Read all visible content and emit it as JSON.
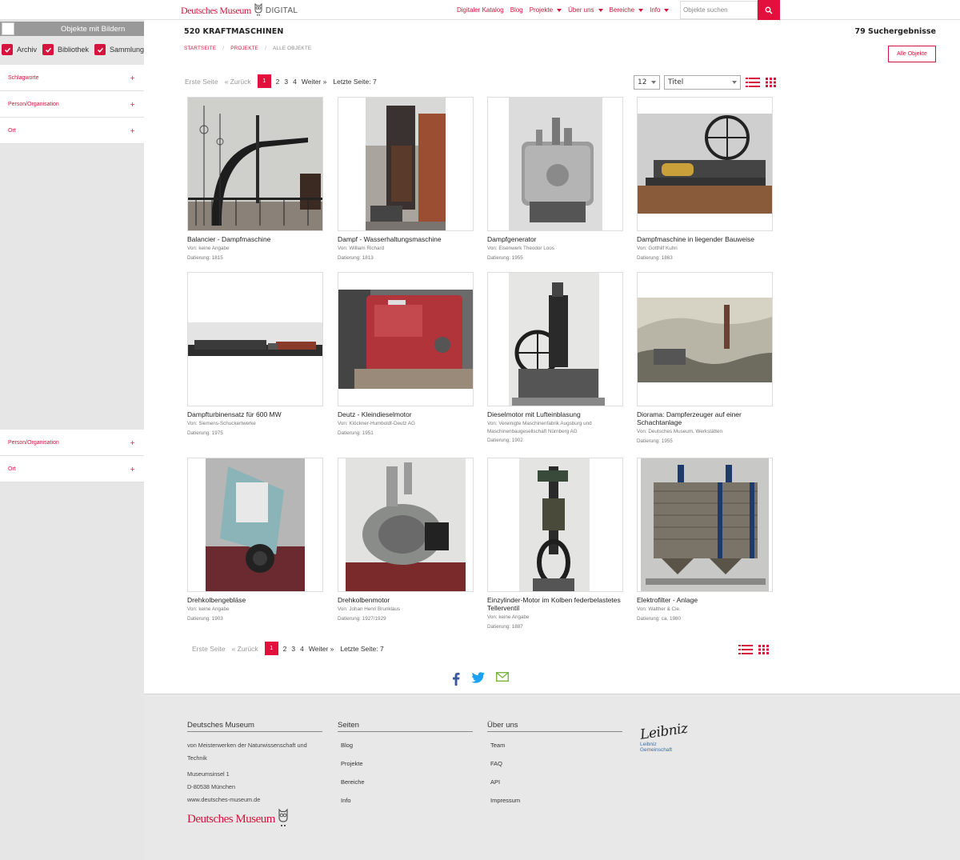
{
  "header": {
    "brand": "Deutsches Museum",
    "digital": "DIGITAL",
    "nav": [
      {
        "label": "Digitaler Katalog",
        "dropdown": false
      },
      {
        "label": "Blog",
        "dropdown": false
      },
      {
        "label": "Projekte",
        "dropdown": true
      },
      {
        "label": "Über uns",
        "dropdown": true
      },
      {
        "label": "Bereiche",
        "dropdown": true
      },
      {
        "label": "Info",
        "dropdown": true
      }
    ],
    "search_placeholder": "Objekte suchen"
  },
  "sidebar": {
    "with_images_label": "Objekte mit Bildern",
    "types": [
      "Archiv",
      "Bibliothek",
      "Sammlung"
    ],
    "facets": [
      "Schlagworte",
      "Person/Organisation",
      "Ort"
    ],
    "facets_lower": [
      "Person/Organisation",
      "Ort"
    ],
    "plus": "+"
  },
  "main": {
    "title": "520 KRAFTMASCHINEN",
    "result_count": "79 Suchergebnisse",
    "breadcrumb": [
      "STARTSEITE",
      "PROJEKTE",
      "ALLE OBJEKTE"
    ],
    "all_objects_btn": "Alle Objekte",
    "pager": {
      "first": "Erste Seite",
      "prev": "« Zurück",
      "pages": [
        "1",
        "2",
        "3",
        "4"
      ],
      "next": "Weiter »",
      "last": "Letzte Seite: 7"
    },
    "per_page": "12",
    "sort": "Titel"
  },
  "objects": [
    {
      "title": "Balancier - Dampfmaschine",
      "by": "Von: keine Angabe",
      "date": "Datierung: 1815"
    },
    {
      "title": "Dampf - Wasserhaltungsmaschine",
      "by": "Von: William Richard",
      "date": "Datierung: 1813"
    },
    {
      "title": "Dampfgenerator",
      "by": "Von: Eisenwerk Theodor Loos",
      "date": "Datierung: 1955"
    },
    {
      "title": "Dampfmaschine in liegender Bauweise",
      "by": "Von: Gotthilf Kuhn",
      "date": "Datierung: 1863"
    },
    {
      "title": "Dampfturbinensatz für 600 MW",
      "by": "Von: Siemens-Schuckertwerke",
      "date": "Datierung: 1975"
    },
    {
      "title": "Deutz - Kleindieselmotor",
      "by": "Von: Klöckner-Humboldt-Deutz AG",
      "date": "Datierung: 1951"
    },
    {
      "title": "Dieselmotor mit Lufteinblasung",
      "by": "Von: Vereinigte Maschinenfabrik Augsburg und Maschinenbaugesellschaft Nürnberg AG",
      "date": "Datierung: 1902"
    },
    {
      "title": "Diorama: Dampferzeuger auf einer Schachtanlage",
      "by": "Von: Deutsches Museum, Werkstätten",
      "date": "Datierung: 1955"
    },
    {
      "title": "Drehkolbengebläse",
      "by": "Von: keine Angabe",
      "date": "Datierung: 1903"
    },
    {
      "title": "Drehkolbenmotor",
      "by": "Von: Johan Henri Brunklaus",
      "date": "Datierung: 1927/1929"
    },
    {
      "title": "Einzylinder-Motor im Kolben federbelastetes Tellerventil",
      "by": "Von: keine Angabe",
      "date": "Datierung: 1887"
    },
    {
      "title": "Elektrofilter - Anlage",
      "by": "Von: Walther & Cie.",
      "date": "Datierung: ca. 1980"
    }
  ],
  "footer": {
    "col1": {
      "title": "Deutsches Museum",
      "lines": [
        "von Meisterwerken der Naturwissenschaft und Technik",
        "Museumsinsel 1",
        "D-80538 München",
        "www.deutsches-museum.de"
      ],
      "logo": "Deutsches Museum"
    },
    "col2": {
      "title": "Seiten",
      "links": [
        "Blog",
        "Projekte",
        "Bereiche",
        "Info"
      ]
    },
    "col3": {
      "title": "Über uns",
      "links": [
        "Team",
        "FAQ",
        "API",
        "Impressum"
      ]
    },
    "leibniz": {
      "script": "Leibniz",
      "line1": "Leibniz",
      "line2": "Gemeinschaft"
    }
  },
  "colors": {
    "accent": "#e30f3c",
    "brand": "#d4143c"
  }
}
